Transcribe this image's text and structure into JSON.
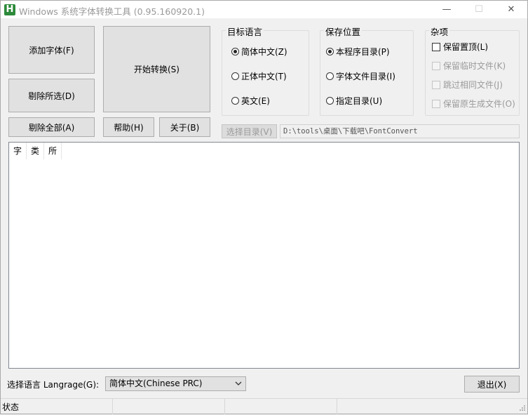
{
  "window": {
    "app_icon_letter": "H",
    "title": "Windows 系统字体转换工具 (0.95.160920.1)",
    "minimize_glyph": "—",
    "maximize_glyph": "☐",
    "close_glyph": "✕"
  },
  "buttons": {
    "add_font": "添加字体(F)",
    "start_convert": "开始转换(S)",
    "remove_selected": "剔除所选(D)",
    "remove_all": "剔除全部(A)",
    "help": "帮助(H)",
    "about": "关于(B)",
    "choose_dir": "选择目录(V)",
    "exit": "退出(X)"
  },
  "target_language": {
    "label": "目标语言",
    "options": [
      "简体中文(Z)",
      "正体中文(T)",
      "英文(E)"
    ],
    "selected_index": 0
  },
  "save_location": {
    "label": "保存位置",
    "options": [
      "本程序目录(P)",
      "字体文件目录(I)",
      "指定目录(U)"
    ],
    "selected_index": 0
  },
  "misc": {
    "label": "杂项",
    "items": [
      {
        "label": "保留置顶(L)",
        "checked": false,
        "enabled": true
      },
      {
        "label": "保留临时文件(K)",
        "checked": false,
        "enabled": false
      },
      {
        "label": "跳过相同文件(J)",
        "checked": false,
        "enabled": false
      },
      {
        "label": "保留原生成文件(O)",
        "checked": false,
        "enabled": false
      }
    ]
  },
  "dir_path": "D:\\tools\\桌面\\下载吧\\FontConvert",
  "list": {
    "columns": [
      "字",
      "类",
      "所"
    ]
  },
  "language_select": {
    "label": "选择语言 Langrage(G):",
    "value": "简体中文(Chinese PRC)"
  },
  "status": {
    "text": "状态"
  }
}
